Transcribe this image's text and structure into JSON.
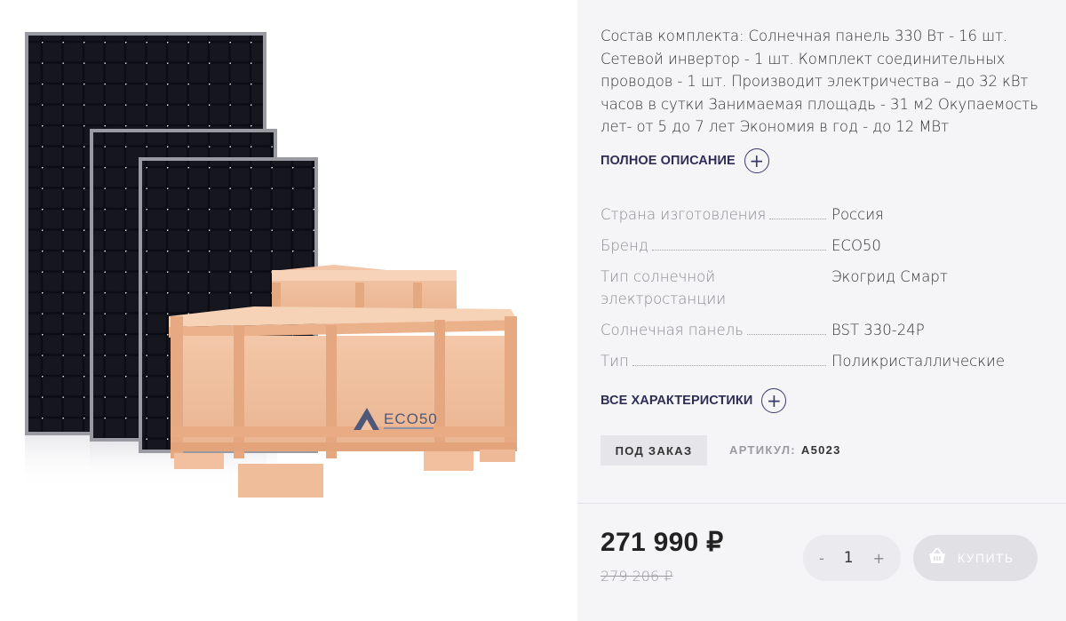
{
  "product": {
    "image_logo_text": "ECO50",
    "description": "Состав комплекта: Солнечная панель 330 Вт - 16 шт. Сетевой инвертор - 1 шт. Комплект соединительных проводов - 1 шт. Производит электричества – до 32 кВт часов в сутки Занимаемая площадь - 31 м2 Окупаемость лет- от 5 до 7 лет Экономия в год - до 12 МВт",
    "full_description_label": "ПОЛНОЕ ОПИСАНИЕ",
    "all_specs_label": "ВСЕ ХАРАКТЕРИСТИКИ",
    "specs": [
      {
        "name": "Страна изготовления",
        "value": "Россия"
      },
      {
        "name": "Бренд",
        "value": "ECO50"
      },
      {
        "name": "Тип солнечной электростанции",
        "value": "Экогрид Смарт"
      },
      {
        "name": "Солнечная панель",
        "value": "BST 330-24P"
      },
      {
        "name": "Тип",
        "value": "Поликристаллические"
      }
    ],
    "availability": "ПОД ЗАКАЗ",
    "article_label": "АРТИКУЛ:",
    "article_value": "A5023"
  },
  "purchase": {
    "price": "271 990 ₽",
    "old_price": "279 206 ₽",
    "quantity": "1",
    "minus": "-",
    "plus": "+",
    "buy_label": "КУПИТЬ"
  },
  "colors": {
    "accent": "#2d2d55",
    "panel_bg": "#f5f5f7",
    "button_bg": "#e0e0e5"
  },
  "icons": {
    "expand": "plus-circle-icon",
    "cart": "basket-icon"
  }
}
